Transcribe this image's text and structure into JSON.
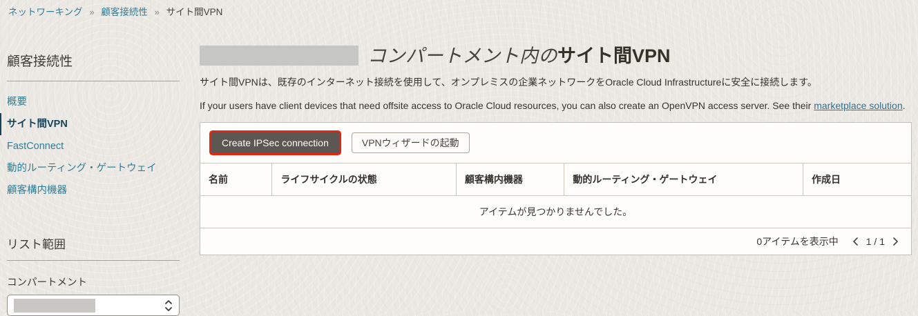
{
  "breadcrumb": {
    "separator": "»",
    "items": [
      {
        "label": "ネットワーキング",
        "link": true
      },
      {
        "label": "顧客接続性",
        "link": true
      },
      {
        "label": "サイト間VPN",
        "link": false
      }
    ]
  },
  "sidebar": {
    "heading": "顧客接続性",
    "items": [
      {
        "label": "概要",
        "active": false
      },
      {
        "label": "サイト間VPN",
        "active": true
      },
      {
        "label": "FastConnect",
        "active": false
      },
      {
        "label": "動的ルーティング・ゲートウェイ",
        "active": false
      },
      {
        "label": "顧客構内機器",
        "active": false
      }
    ],
    "list_scope_heading": "リスト範囲",
    "compartment_label": "コンパートメント",
    "compartment_value_redacted": true
  },
  "main": {
    "title_compartment_redacted": true,
    "title_middle": "コンパートメント内の",
    "title_resource": "サイト間VPN",
    "description_ja": "サイト間VPNは、既存のインターネット接続を使用して、オンプレミスの企業ネットワークをOracle Cloud Infrastructureに安全に接続します。",
    "description_en_before_link": "If your users have client devices that need offsite access to Oracle Cloud resources, you can also create an OpenVPN access server. See their ",
    "description_en_link": "marketplace solution",
    "description_en_after_link": ".",
    "buttons": {
      "create": "Create IPSec connection",
      "wizard": "VPNウィザードの起動"
    },
    "table": {
      "columns": [
        "名前",
        "ライフサイクルの状態",
        "顧客構内機器",
        "動的ルーティング・ゲートウェイ",
        "作成日"
      ],
      "empty_message": "アイテムが見つかりませんでした。",
      "pagination": {
        "summary": "0アイテムを表示中",
        "page_indicator": "1 / 1"
      }
    }
  },
  "icons": {
    "breadcrumb_separator": "double-angle-right",
    "compartment_selector": "select-updown-chevrons-icon",
    "pager_prev": "chevron-left-icon",
    "pager_next": "chevron-right-icon"
  },
  "colors": {
    "background_beige": "#ebe8e3",
    "link_teal": "#2e7d98",
    "active_nav_teal": "#16425a",
    "button_dark_bg": "#5d5753",
    "highlight_red": "#e8230d",
    "card_border": "#c5c0b8"
  }
}
